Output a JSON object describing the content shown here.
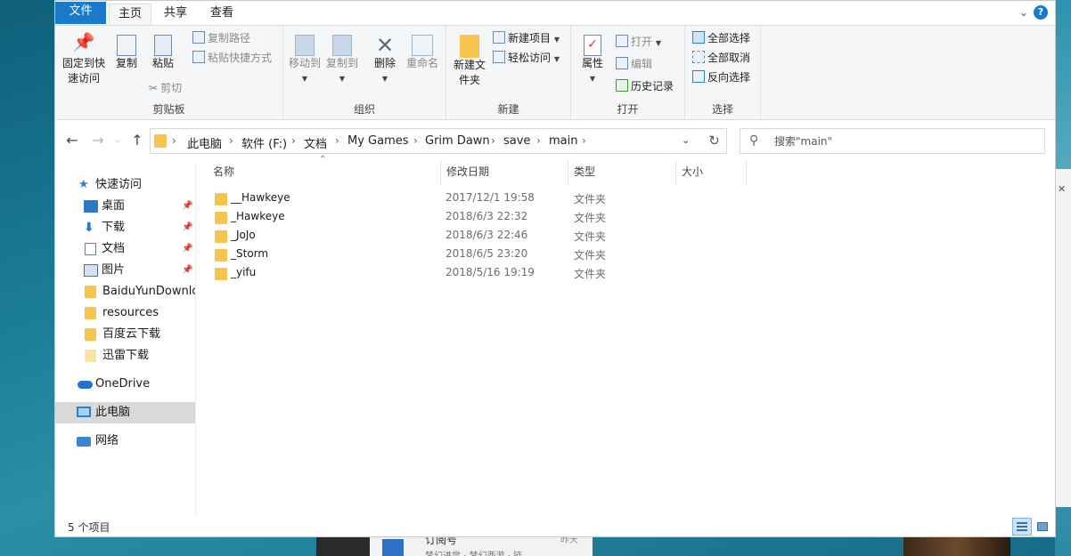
{
  "ribbon_tabs": {
    "file": "文件",
    "home": "主页",
    "share": "共享",
    "view": "查看"
  },
  "help_icon": "?",
  "ribbon": {
    "clipboard": {
      "label": "剪贴板",
      "pin_quick_access": "固定到快速访问",
      "copy": "复制",
      "paste": "粘贴",
      "copy_path": "复制路径",
      "paste_shortcut": "粘贴快捷方式",
      "cut": "剪切"
    },
    "organize": {
      "label": "组织",
      "move_to": "移动到",
      "copy_to": "复制到",
      "delete": "删除",
      "rename": "重命名"
    },
    "new": {
      "label": "新建",
      "new_item": "新建项目",
      "easy_access": "轻松访问",
      "new_folder": "新建文件夹"
    },
    "open": {
      "label": "打开",
      "properties": "属性",
      "open": "打开",
      "edit": "编辑",
      "history": "历史记录"
    },
    "select": {
      "label": "选择",
      "select_all": "全部选择",
      "select_none": "全部取消",
      "invert": "反向选择"
    }
  },
  "address": {
    "crumbs": [
      "此电脑",
      "软件 (F:)",
      "文档",
      "My Games",
      "Grim Dawn",
      "save",
      "main"
    ],
    "separator": "›"
  },
  "search": {
    "placeholder": "搜索\"main\""
  },
  "sidebar": {
    "quick_access": "快速访问",
    "pinned": [
      {
        "label": "桌面",
        "icon": "desktop-icon"
      },
      {
        "label": "下载",
        "icon": "download-icon"
      },
      {
        "label": "文档",
        "icon": "document-icon"
      },
      {
        "label": "图片",
        "icon": "picture-icon"
      }
    ],
    "folders": [
      "BaiduYunDownload",
      "resources",
      "百度云下载",
      "迅雷下载"
    ],
    "onedrive": "OneDrive",
    "this_pc": "此电脑",
    "network": "网络"
  },
  "columns": {
    "name": "名称",
    "date": "修改日期",
    "type": "类型",
    "size": "大小"
  },
  "files": [
    {
      "name": "__Hawkeye",
      "date": "2017/12/1 19:58",
      "type": "文件夹"
    },
    {
      "name": "_Hawkeye",
      "date": "2018/6/3 22:32",
      "type": "文件夹"
    },
    {
      "name": "_JoJo",
      "date": "2018/6/3 22:46",
      "type": "文件夹"
    },
    {
      "name": "_Storm",
      "date": "2018/6/5 23:20",
      "type": "文件夹"
    },
    {
      "name": "_yifu",
      "date": "2018/5/16 19:19",
      "type": "文件夹"
    }
  ],
  "status": {
    "count": "5 个项目"
  },
  "desktop": {
    "card_title": "订阅号",
    "card_sub": "梦幻进尝 · 梦幻西游 · 链",
    "card_time": "昨天",
    "side_close": "✕"
  },
  "colors": {
    "accent": "#1979ca",
    "folder": "#f6c44f",
    "selected": "#d9d9d9"
  }
}
